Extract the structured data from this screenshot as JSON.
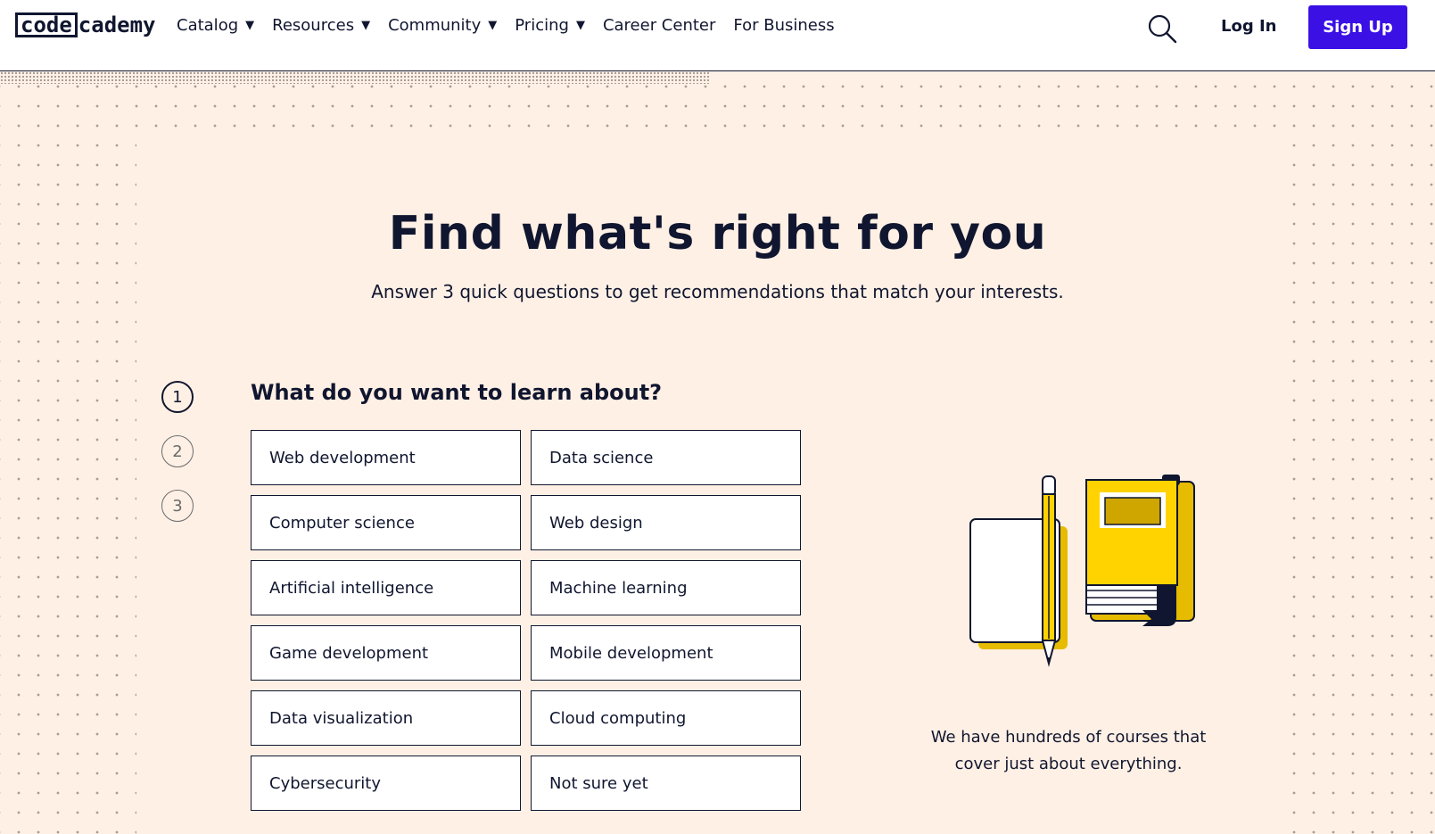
{
  "header": {
    "logo": {
      "part1": "code",
      "part2": "cademy"
    },
    "nav": [
      {
        "label": "Catalog",
        "dropdown": true
      },
      {
        "label": "Resources",
        "dropdown": true
      },
      {
        "label": "Community",
        "dropdown": true
      },
      {
        "label": "Pricing",
        "dropdown": true
      },
      {
        "label": "Career Center",
        "dropdown": false
      },
      {
        "label": "For Business",
        "dropdown": false
      }
    ],
    "caret": "▼",
    "search_icon": "search-icon",
    "login_label": "Log In",
    "signup_label": "Sign Up"
  },
  "hero": {
    "title": "Find what's right for you",
    "subtitle": "Answer 3 quick questions to get recommendations that match your interests."
  },
  "steps": [
    "1",
    "2",
    "3"
  ],
  "question": "What do you want to learn about?",
  "options": [
    "Web development",
    "Data science",
    "Computer science",
    "Web design",
    "Artificial intelligence",
    "Machine learning",
    "Game development",
    "Mobile development",
    "Data visualization",
    "Cloud computing",
    "Cybersecurity",
    "Not sure yet"
  ],
  "caption": "We have hundreds of courses that cover just about everything.",
  "colors": {
    "brand": "#3a10e5",
    "ink": "#10162f",
    "background": "#fff0e5",
    "yellow": "#ffd300"
  }
}
